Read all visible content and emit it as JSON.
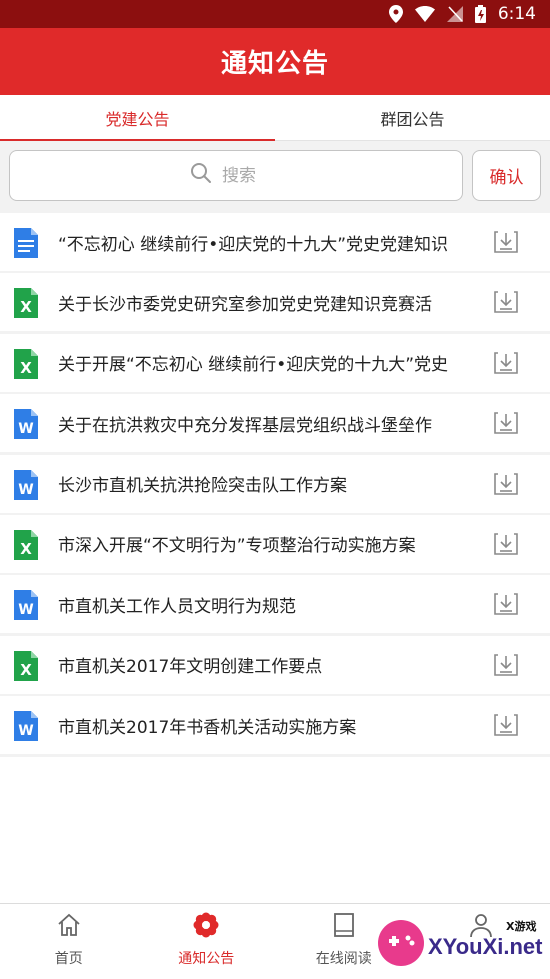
{
  "status_bar": {
    "time": "6:14"
  },
  "header": {
    "title": "通知公告"
  },
  "tabs": [
    {
      "label": "党建公告",
      "active": true
    },
    {
      "label": "群团公告",
      "active": false
    }
  ],
  "search": {
    "placeholder": "搜索",
    "confirm_label": "确认"
  },
  "files": [
    {
      "type": "doc",
      "title": "“不忘初心 继续前行•迎庆党的十九大”党史党建知识"
    },
    {
      "type": "xls",
      "title": "关于长沙市委党史研究室参加党史党建知识竞赛活"
    },
    {
      "type": "xls",
      "title": "关于开展“不忘初心 继续前行•迎庆党的十九大”党史"
    },
    {
      "type": "word",
      "title": "关于在抗洪救灾中充分发挥基层党组织战斗堡垒作"
    },
    {
      "type": "word",
      "title": "长沙市直机关抗洪抢险突击队工作方案"
    },
    {
      "type": "xls",
      "title": "市深入开展“不文明行为”专项整治行动实施方案"
    },
    {
      "type": "word",
      "title": "市直机关工作人员文明行为规范"
    },
    {
      "type": "xls",
      "title": "市直机关2017年文明创建工作要点"
    },
    {
      "type": "word",
      "title": "市直机关2017年书香机关活动实施方案"
    }
  ],
  "bottom_nav": [
    {
      "label": "首页",
      "icon": "home-icon",
      "active": false
    },
    {
      "label": "通知公告",
      "icon": "flower-icon",
      "active": true
    },
    {
      "label": "在线阅读",
      "icon": "book-icon",
      "active": false
    },
    {
      "label": "",
      "icon": "user-icon",
      "active": false
    }
  ],
  "watermark": {
    "text": "XYouXi.net",
    "small": "X游戏"
  },
  "colors": {
    "header": "#e02a2a",
    "status_bar": "#8c0f0f",
    "accent": "#d92b2b",
    "doc_blue": "#2f7ee6",
    "xls_green": "#21a34a"
  }
}
